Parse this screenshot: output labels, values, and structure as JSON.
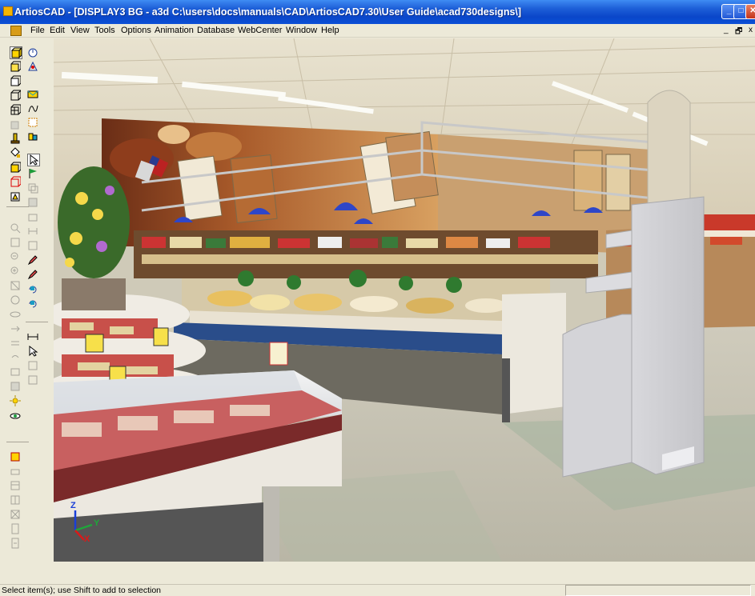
{
  "window": {
    "title": "ArtiosCAD - [DISPLAY3 BG - a3d C:\\users\\docs\\manuals\\CAD\\ArtiosCAD7.30\\User Guide\\acad730designs\\]",
    "minimize_glyph": "_",
    "maximize_glyph": "□",
    "close_glyph": "✕"
  },
  "menu": {
    "items": [
      "File",
      "Edit",
      "View",
      "Tools",
      "Options",
      "Animation",
      "Database",
      "WebCenter",
      "Window",
      "Help"
    ],
    "mdi_minimize": "_",
    "mdi_restore": "🗗",
    "mdi_close": "x"
  },
  "toolbar": {
    "icons": [
      "view-solid-icon",
      "view-3d-icon",
      "view-wire-icon",
      "view-box-icon",
      "view-grid-icon",
      "view-cut-icon",
      "fold-icon",
      "fill-icon",
      "rotate-icon",
      "stack-icon",
      "pallet-icon",
      "zoom-in-icon",
      "zoom-out-icon",
      "pan-icon",
      "measure-icon",
      "light-icon",
      "eye-icon"
    ]
  },
  "viewport": {
    "axis": {
      "z": "Z",
      "y": "Y",
      "x": "X"
    }
  },
  "status": {
    "text": "Select item(s); use Shift to add to selection",
    "panel_text": ""
  }
}
